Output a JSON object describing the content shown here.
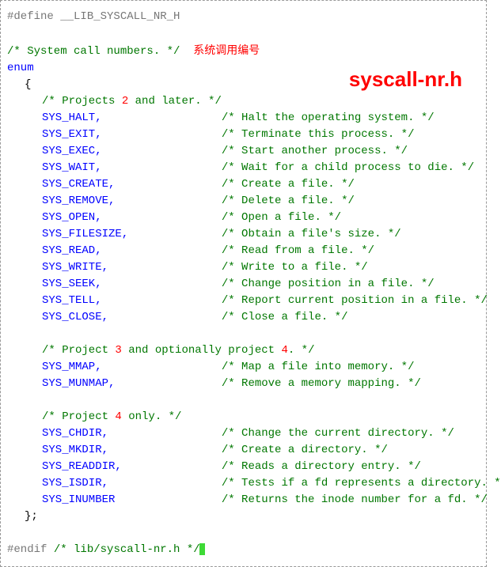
{
  "title_overlay": "syscall-nr.h",
  "zh_annotation": "系统调用编号",
  "pp_define": "#define __LIB_SYSCALL_NR_H",
  "comment_header": "/* System call numbers. */",
  "kw_enum": "enum",
  "brace_open": "{",
  "group1": {
    "pre": "/* Projects ",
    "num": "2",
    "post": " and later. */"
  },
  "entries1": [
    {
      "name": "SYS_HALT,",
      "cm": "/* Halt the operating system. */"
    },
    {
      "name": "SYS_EXIT,",
      "cm": "/* Terminate this process. */"
    },
    {
      "name": "SYS_EXEC,",
      "cm": "/* Start another process. */"
    },
    {
      "name": "SYS_WAIT,",
      "cm": "/* Wait for a child process to die. */"
    },
    {
      "name": "SYS_CREATE,",
      "cm": "/* Create a file. */"
    },
    {
      "name": "SYS_REMOVE,",
      "cm": "/* Delete a file. */"
    },
    {
      "name": "SYS_OPEN,",
      "cm": "/* Open a file. */"
    },
    {
      "name": "SYS_FILESIZE,",
      "cm": "/* Obtain a file's size. */"
    },
    {
      "name": "SYS_READ,",
      "cm": "/* Read from a file. */"
    },
    {
      "name": "SYS_WRITE,",
      "cm": "/* Write to a file. */"
    },
    {
      "name": "SYS_SEEK,",
      "cm": "/* Change position in a file. */"
    },
    {
      "name": "SYS_TELL,",
      "cm": "/* Report current position in a file. */"
    },
    {
      "name": "SYS_CLOSE,",
      "cm": "/* Close a file. */"
    }
  ],
  "group2": {
    "pre": "/* Project ",
    "num": "3",
    "mid": " and optionally project ",
    "num2": "4",
    "post": ". */"
  },
  "entries2": [
    {
      "name": "SYS_MMAP,",
      "cm": "/* Map a file into memory. */"
    },
    {
      "name": "SYS_MUNMAP,",
      "cm": "/* Remove a memory mapping. */"
    }
  ],
  "group3": {
    "pre": "/* Project ",
    "num": "4",
    "post": " only. */"
  },
  "entries3": [
    {
      "name": "SYS_CHDIR,",
      "cm": "/* Change the current directory. */"
    },
    {
      "name": "SYS_MKDIR,",
      "cm": "/* Create a directory. */"
    },
    {
      "name": "SYS_READDIR,",
      "cm": "/* Reads a directory entry. */"
    },
    {
      "name": "SYS_ISDIR,",
      "cm": "/* Tests if a fd represents a directory. */"
    },
    {
      "name": "SYS_INUMBER",
      "cm": "/* Returns the inode number for a fd. */"
    }
  ],
  "brace_close": "};",
  "pp_endif": "#endif",
  "endif_cm": "/* lib/syscall-nr.h */"
}
